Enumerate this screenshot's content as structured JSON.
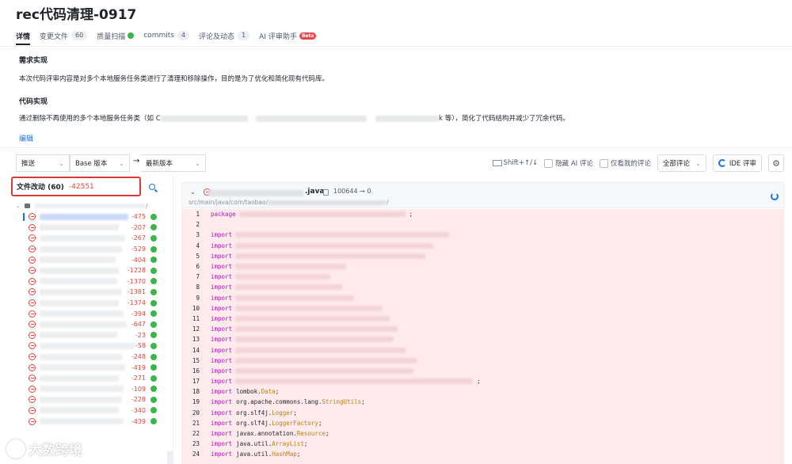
{
  "page": {
    "title": "rec代码清理-0917"
  },
  "tabs": [
    {
      "label": "详情",
      "count": ""
    },
    {
      "label": "变更文件",
      "count": "60"
    },
    {
      "label": "质量扫描",
      "count": ""
    },
    {
      "label": "commits",
      "count": "4"
    },
    {
      "label": "评论及动态",
      "count": "1"
    },
    {
      "label": "AI 评审助手",
      "badge": "Beta"
    }
  ],
  "description": {
    "req_heading": "需求实现",
    "req_text": "本次代码评审内容是对多个本地服务任务类进行了清理和移除操作，目的是为了优化和简化现有代码库。",
    "code_heading": "代码实现",
    "code_text_prefix": "通过删除不再使用的多个本地服务任务类（如 C",
    "code_text_mid": "k",
    "code_text_suffix": "等），简化了代码结构并减少了冗余代码。",
    "edit_label": "编辑"
  },
  "toolbar": {
    "push_select": "推送",
    "base_select": "Base 版本",
    "arrow": "→",
    "latest_select": "最新版本",
    "shortcut": "Shift+↑/↓",
    "hide_ai": "隐藏 AI 评论",
    "only_mine": "仅看我的评论",
    "all_comments": "全部评论",
    "ide_review": "IDE 评审"
  },
  "file_panel": {
    "label": "文件改动 (60)",
    "total_deleted": "-42551",
    "root_suffix": "/",
    "files": [
      {
        "deleted": "-475"
      },
      {
        "deleted": "-207"
      },
      {
        "deleted": "-267"
      },
      {
        "deleted": "-529"
      },
      {
        "deleted": "-404"
      },
      {
        "deleted": "-1228"
      },
      {
        "deleted": "-1370"
      },
      {
        "deleted": "-1381"
      },
      {
        "deleted": "-1374"
      },
      {
        "deleted": "-394"
      },
      {
        "deleted": "-647"
      },
      {
        "deleted": "-23"
      },
      {
        "deleted": "-58"
      },
      {
        "deleted": "-248"
      },
      {
        "deleted": "-419"
      },
      {
        "deleted": "-271"
      },
      {
        "deleted": "-109"
      },
      {
        "deleted": "-228"
      },
      {
        "deleted": "-340"
      },
      {
        "deleted": "-439"
      }
    ]
  },
  "diff": {
    "file_ext": ".java",
    "mode": "100644 → 0",
    "path_prefix": "src/main/java/com/taobao/",
    "path_suffix": "/",
    "lines": [
      {
        "n": "1",
        "kw": "package",
        "text": "",
        "type": "",
        "tail": ";",
        "blur": 210
      },
      {
        "n": "2",
        "kw": "",
        "text": "",
        "type": "",
        "tail": "",
        "blur": 0
      },
      {
        "n": "3",
        "kw": "import",
        "text": "",
        "type": "",
        "tail": "",
        "blur": 270
      },
      {
        "n": "4",
        "kw": "import",
        "text": "",
        "type": "",
        "tail": "",
        "blur": 250
      },
      {
        "n": "5",
        "kw": "import",
        "text": "",
        "type": "",
        "tail": "",
        "blur": 240
      },
      {
        "n": "6",
        "kw": "import",
        "text": "",
        "type": "",
        "tail": "",
        "blur": 140
      },
      {
        "n": "7",
        "kw": "import",
        "text": "",
        "type": "",
        "tail": "",
        "blur": 120
      },
      {
        "n": "8",
        "kw": "import",
        "text": "",
        "type": "",
        "tail": "",
        "blur": 135
      },
      {
        "n": "9",
        "kw": "import",
        "text": "",
        "type": "",
        "tail": "",
        "blur": 150
      },
      {
        "n": "10",
        "kw": "import",
        "text": "",
        "type": "",
        "tail": "",
        "blur": 185
      },
      {
        "n": "11",
        "kw": "import",
        "text": "",
        "type": "",
        "tail": "",
        "blur": 195
      },
      {
        "n": "12",
        "kw": "import",
        "text": "",
        "type": "",
        "tail": "",
        "blur": 205
      },
      {
        "n": "13",
        "kw": "import",
        "text": "",
        "type": "",
        "tail": "",
        "blur": 200
      },
      {
        "n": "14",
        "kw": "import",
        "text": "",
        "type": "",
        "tail": "",
        "blur": 215
      },
      {
        "n": "15",
        "kw": "import",
        "text": "",
        "type": "",
        "tail": "",
        "blur": 230
      },
      {
        "n": "16",
        "kw": "import",
        "text": "",
        "type": "",
        "tail": "",
        "blur": 225
      },
      {
        "n": "17",
        "kw": "import",
        "text": "",
        "type": "",
        "tail": ";",
        "blur": 300
      },
      {
        "n": "18",
        "kw": "import",
        "text": "lombok.",
        "type": "Data",
        "tail": ";",
        "blur": 0
      },
      {
        "n": "19",
        "kw": "import",
        "text": "org.apache.commons.lang.",
        "type": "StringUtils",
        "tail": ";",
        "blur": 0
      },
      {
        "n": "20",
        "kw": "import",
        "text": "org.slf4j.",
        "type": "Logger",
        "tail": ";",
        "blur": 0
      },
      {
        "n": "21",
        "kw": "import",
        "text": "org.slf4j.",
        "type": "LoggerFactory",
        "tail": ";",
        "blur": 0
      },
      {
        "n": "22",
        "kw": "import",
        "text": "javax.annotation.",
        "type": "Resource",
        "tail": ";",
        "blur": 0
      },
      {
        "n": "23",
        "kw": "import",
        "text": "java.util.",
        "type": "ArrayList",
        "tail": ";",
        "blur": 0
      },
      {
        "n": "24",
        "kw": "import",
        "text": "java.util.",
        "type": "HashMap",
        "tail": ";",
        "blur": 0
      }
    ]
  },
  "watermark": {
    "text": "大数跨境"
  },
  "colors": {
    "accent": "#1873e8",
    "deleted": "#e0463f",
    "ok": "#3ab54a",
    "diff_bg": "#ffeaec",
    "keyword": "#a41cb2",
    "type": "#b8830e"
  }
}
